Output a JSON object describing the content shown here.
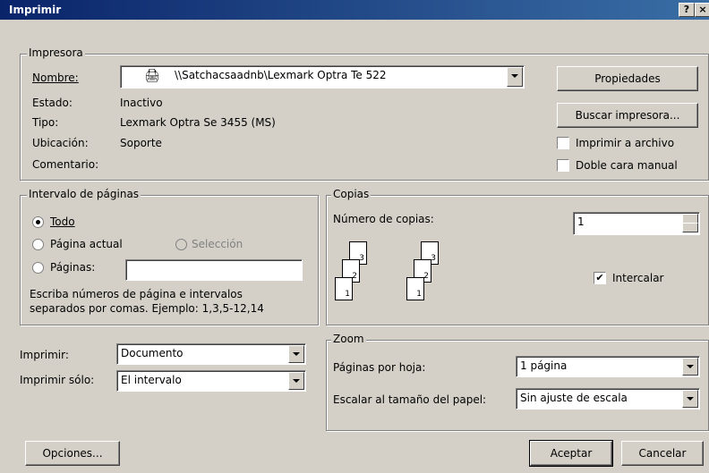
{
  "window": {
    "title": "Imprimir",
    "help_label": "?",
    "close_label": "×"
  },
  "printer": {
    "legend": "Impresora",
    "name_label": "Nombre:",
    "name_value": "\\\\Satchacsaadnb\\Lexmark Optra Te 522",
    "status_label": "Estado:",
    "status_value": "Inactivo",
    "type_label": "Tipo:",
    "type_value": "Lexmark Optra Se 3455 (MS)",
    "location_label": "Ubicación:",
    "location_value": "Soporte",
    "comment_label": "Comentario:",
    "properties_button": "Propiedades",
    "find_button": "Buscar impresora...",
    "print_to_file": {
      "label": "Imprimir a archivo",
      "checked": false
    },
    "manual_duplex": {
      "label": "Doble cara manual",
      "checked": false
    }
  },
  "range": {
    "legend": "Intervalo de páginas",
    "all_label": "Todo",
    "current_label": "Página actual",
    "selection_label": "Selección",
    "pages_label": "Páginas:",
    "pages_value": "",
    "hint": "Escriba números de página e intervalos separados por comas. Ejemplo: 1,3,5-12,14",
    "selected": "all"
  },
  "copies": {
    "legend": "Copias",
    "count_label": "Número de copias:",
    "count_value": "1",
    "collate_label": "Intercalar",
    "collate_checked": true,
    "check_glyph": "✔",
    "page_numbers": [
      "1",
      "2",
      "3"
    ]
  },
  "print": {
    "what_label": "Imprimir:",
    "what_value": "Documento",
    "only_label": "Imprimir sólo:",
    "only_value": "El intervalo"
  },
  "zoom": {
    "legend": "Zoom",
    "pages_per_sheet_label": "Páginas por hoja:",
    "pages_per_sheet_value": "1 página",
    "scale_label": "Escalar al tamaño del papel:",
    "scale_value": "Sin ajuste de escala"
  },
  "footer": {
    "options_button": "Opciones...",
    "ok_button": "Aceptar",
    "cancel_button": "Cancelar"
  }
}
